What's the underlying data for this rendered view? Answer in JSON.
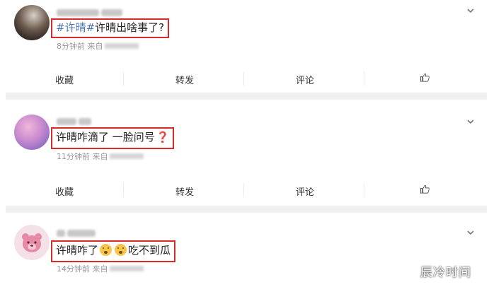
{
  "posts": [
    {
      "hashtag": "#许晴#",
      "text": "许晴出啥事了?",
      "time": "8分钟前",
      "source_prefix": "来自",
      "actions": {
        "collect": "收藏",
        "repost": "转发",
        "comment": "评论"
      }
    },
    {
      "text": "许晴咋滴了 一脸问号",
      "emoji_mark": "❓",
      "time": "11分钟前",
      "source_prefix": "来自",
      "actions": {
        "collect": "收藏",
        "repost": "转发",
        "comment": "评论"
      }
    },
    {
      "text_before": "许晴咋了",
      "text_after": "吃不到瓜",
      "time": "14分钟前",
      "source_prefix": "来自"
    }
  ],
  "icons": {
    "expand": "chevron-down-icon",
    "like": "thumbs-up-icon",
    "emoji": "shushing-face-emoji"
  },
  "colors": {
    "highlight_border": "#d82a2a",
    "hashtag": "#4f78b5",
    "separator": "#f0f0f0"
  },
  "watermark": "辰冷时间"
}
